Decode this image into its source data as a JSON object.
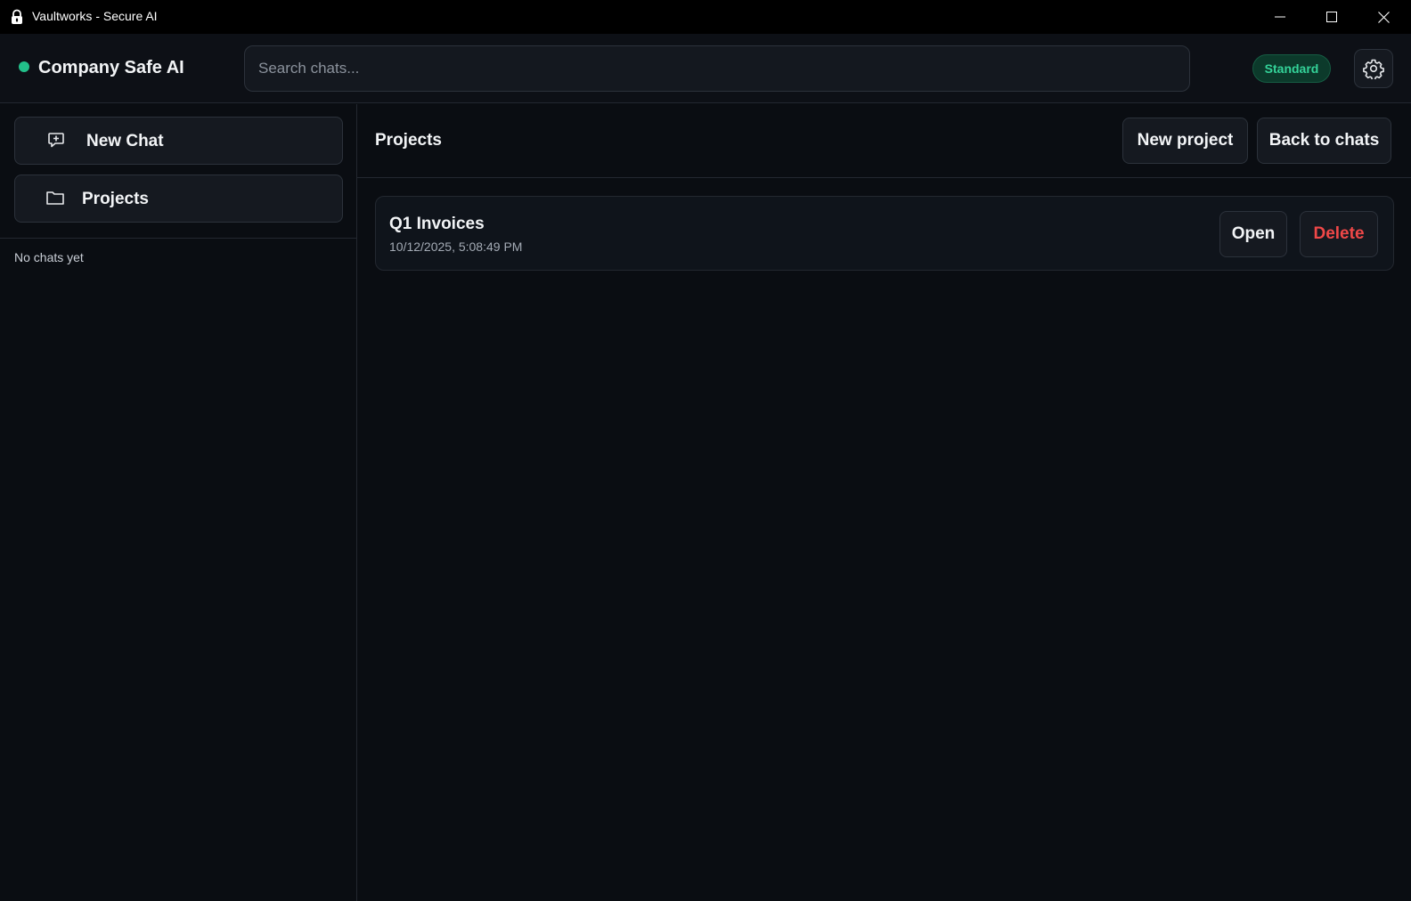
{
  "window": {
    "title": "Vaultworks - Secure AI",
    "app_icon": "lock-icon",
    "controls": [
      "minimize-icon",
      "maximize-icon",
      "close-icon"
    ]
  },
  "header": {
    "status_color": "#22c08a",
    "brand": "Company Safe AI",
    "search_placeholder": "Search chats...",
    "mode_badge": "Standard",
    "settings_icon": "gear-icon"
  },
  "sidebar": {
    "new_chat_label": "New Chat",
    "new_chat_icon": "chat-plus-icon",
    "projects_label": "Projects",
    "projects_icon": "folder-icon",
    "empty_text": "No chats yet"
  },
  "main": {
    "title": "Projects",
    "new_project_label": "New project",
    "back_label": "Back to chats",
    "projects": [
      {
        "name": "Q1 Invoices",
        "date": "10/12/2025, 5:08:49 PM",
        "open_label": "Open",
        "delete_label": "Delete"
      }
    ]
  },
  "colors": {
    "accent_green": "#34d399",
    "danger_red": "#f04848",
    "background": "#0a0d12"
  }
}
